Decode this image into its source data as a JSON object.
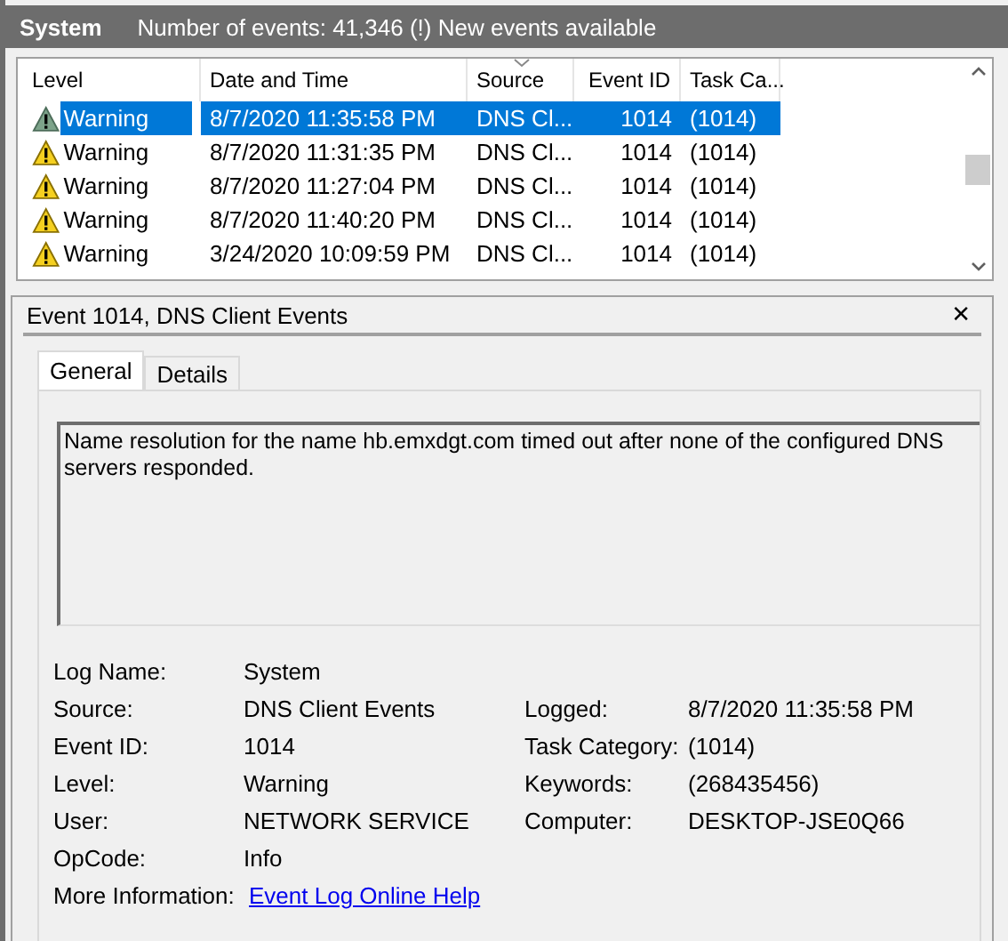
{
  "header": {
    "title": "System",
    "info": "Number of events: 41,346 (!) New events available"
  },
  "table": {
    "columns": [
      {
        "label": "Level",
        "sorted": false
      },
      {
        "label": "Date and Time",
        "sorted": false
      },
      {
        "label": "Source",
        "sorted": true
      },
      {
        "label": "Event ID",
        "sorted": false
      },
      {
        "label": "Task Ca...",
        "sorted": false
      }
    ],
    "rows": [
      {
        "level": "Warning",
        "date": "8/7/2020 11:35:58 PM",
        "source": "DNS Cl...",
        "event_id": "1014",
        "task": "(1014)",
        "selected": true
      },
      {
        "level": "Warning",
        "date": "8/7/2020 11:31:35 PM",
        "source": "DNS Cl...",
        "event_id": "1014",
        "task": "(1014)",
        "selected": false
      },
      {
        "level": "Warning",
        "date": "8/7/2020 11:27:04 PM",
        "source": "DNS Cl...",
        "event_id": "1014",
        "task": "(1014)",
        "selected": false
      },
      {
        "level": "Warning",
        "date": "8/7/2020 11:40:20 PM",
        "source": "DNS Cl...",
        "event_id": "1014",
        "task": "(1014)",
        "selected": false
      },
      {
        "level": "Warning",
        "date": "3/24/2020 10:09:59 PM",
        "source": "DNS Cl...",
        "event_id": "1014",
        "task": "(1014)",
        "selected": false
      }
    ]
  },
  "detail": {
    "title": "Event 1014, DNS Client Events",
    "close": "✕",
    "tabs": [
      {
        "label": "General",
        "selected": true
      },
      {
        "label": "Details",
        "selected": false
      }
    ],
    "message": "Name resolution for the name hb.emxdgt.com timed out after none of the configured DNS servers responded.",
    "fields": [
      {
        "label": "Log Name:",
        "value": "System"
      },
      {
        "label": "Source:",
        "value": "DNS Client Events",
        "label2": "Logged:",
        "value2": "8/7/2020 11:35:58 PM"
      },
      {
        "label": "Event ID:",
        "value": "1014",
        "label2": "Task Category:",
        "value2": "(1014)"
      },
      {
        "label": "Level:",
        "value": "Warning",
        "label2": "Keywords:",
        "value2": "(268435456)"
      },
      {
        "label": "User:",
        "value": "NETWORK SERVICE",
        "label2": "Computer:",
        "value2": "DESKTOP-JSE0Q66"
      },
      {
        "label": "OpCode:",
        "value": "Info"
      },
      {
        "label": "More Information:",
        "value": "Event Log Online Help",
        "kind": "link"
      }
    ]
  }
}
